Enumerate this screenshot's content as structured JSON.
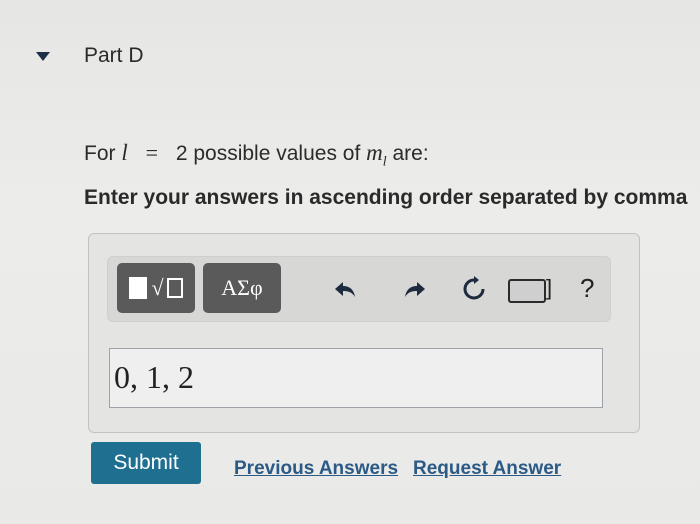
{
  "part": {
    "title": "Part D",
    "caret_icon": "caret-down-icon"
  },
  "question": {
    "prefix": "For",
    "var_l": "l",
    "equals": "=",
    "value": "2 possible values of",
    "var_ml": "m",
    "sub": "l",
    "suffix": "are:"
  },
  "instruction": "Enter your answers in ascending order separated by comma",
  "toolbar": {
    "templates_icon": "templates-icon",
    "symbols_label": "ΑΣφ",
    "undo_icon": "undo-icon",
    "redo_icon": "redo-icon",
    "reset_icon": "reset-icon",
    "keyboard_icon": "keyboard-icon",
    "bracket": "]",
    "help": "?"
  },
  "answer": {
    "value": "0, 1, 2"
  },
  "actions": {
    "submit": "Submit",
    "previous_answers": "Previous Answers",
    "request_answer": "Request Answer"
  },
  "colors": {
    "submit_bg": "#1f6f91",
    "link": "#2a5a85",
    "toolbar_button": "#5a5a5a"
  }
}
